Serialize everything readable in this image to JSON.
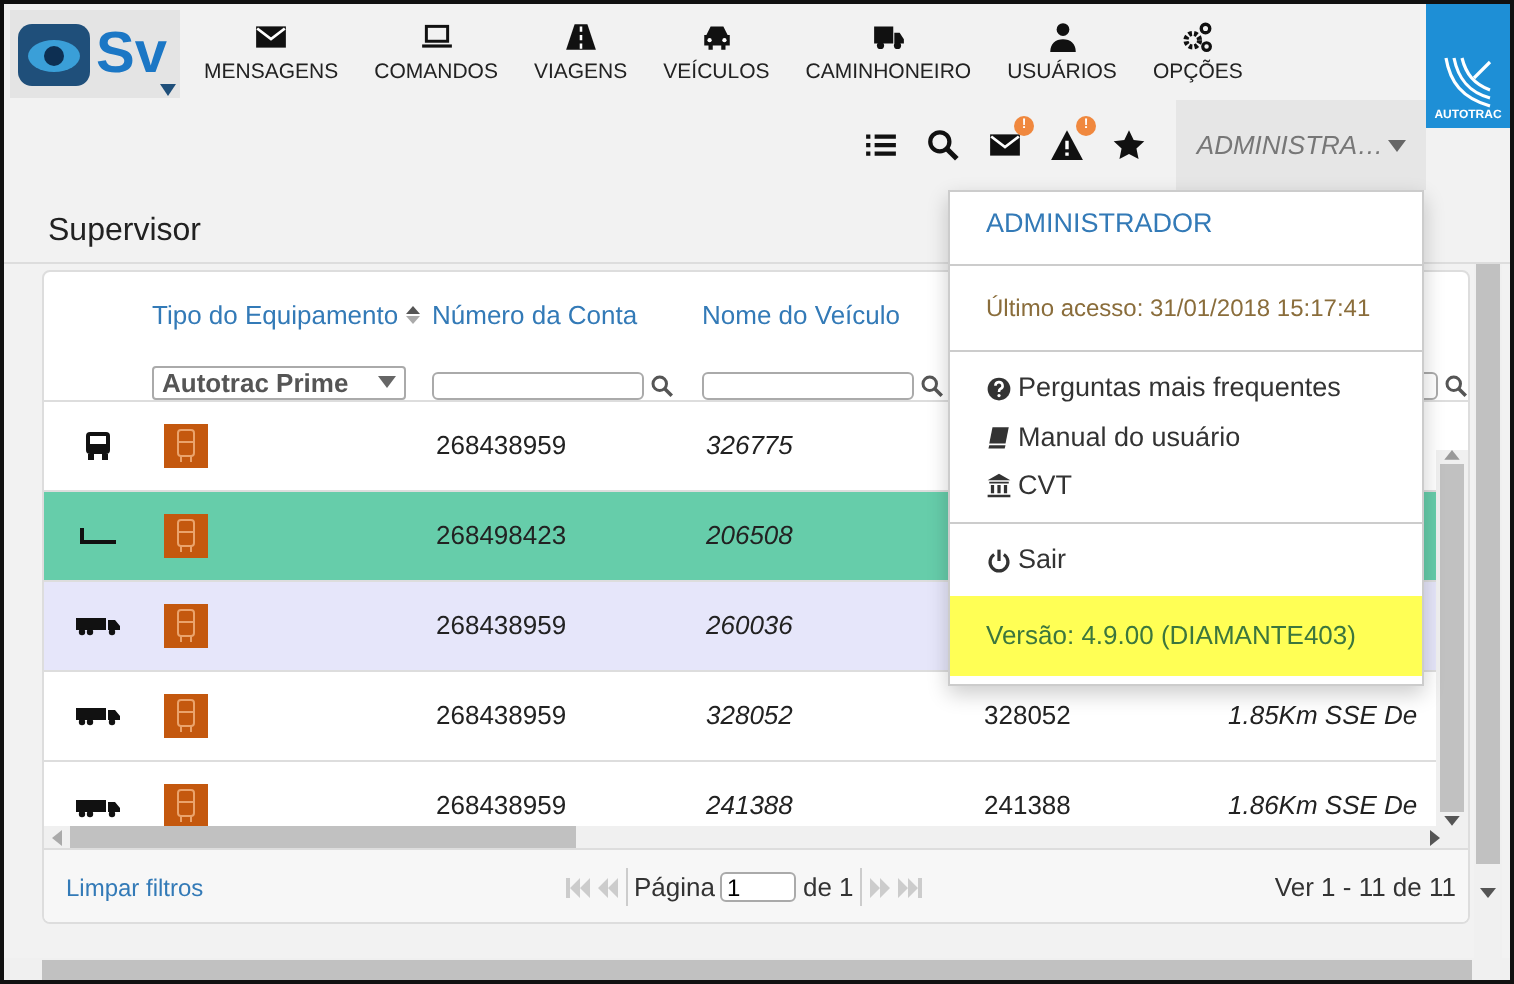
{
  "app": {
    "logo_text": "Sv"
  },
  "nav": [
    {
      "kind": "envelope",
      "label": "MENSAGENS"
    },
    {
      "kind": "laptop",
      "label": "COMANDOS"
    },
    {
      "kind": "road",
      "label": "VIAGENS"
    },
    {
      "kind": "car",
      "label": "VEÍCULOS"
    },
    {
      "kind": "truck",
      "label": "CAMINHONEIRO"
    },
    {
      "kind": "user",
      "label": "USUÁRIOS"
    },
    {
      "kind": "gears",
      "label": "OPÇÕES"
    }
  ],
  "brand": {
    "label": "AUTOTRAC"
  },
  "toolbar": [
    {
      "kind": "list"
    },
    {
      "kind": "search"
    },
    {
      "kind": "envelope",
      "badge": "!"
    },
    {
      "kind": "warning",
      "badge": "!"
    },
    {
      "kind": "star"
    }
  ],
  "user_menu": {
    "label": "ADMINISTRA…",
    "expanded": true
  },
  "page_title": "Supervisor",
  "table": {
    "columns": [
      {
        "label": "Tipo do Equipamento",
        "sortable": true
      },
      {
        "label": "Número da Conta"
      },
      {
        "label": "Nome do Veículo"
      }
    ],
    "filters": [
      {
        "kind": "select",
        "value": "Autotrac Prime"
      },
      {
        "kind": "search"
      },
      {
        "kind": "search"
      },
      {
        "kind": "none"
      },
      {
        "kind": "search"
      }
    ],
    "rows": [
      {
        "kind": "bus",
        "account": "268438959",
        "name": "326775",
        "selected": false,
        "highlighted": false
      },
      {
        "kind": "trailer",
        "account": "268498423",
        "name": "206508",
        "selected": true,
        "highlighted": false
      },
      {
        "kind": "truck",
        "account": "268438959",
        "name": "260036",
        "selected": false,
        "highlighted": true
      },
      {
        "kind": "truck",
        "account": "268438959",
        "name": "328052",
        "column_5": "328052",
        "column_6": "1.85Km SSE De",
        "selected": false,
        "highlighted": false
      },
      {
        "kind": "truck",
        "account": "268438959",
        "name": "241388",
        "column_5": "241388",
        "column_6": "1.86Km SSE De",
        "selected": false,
        "highlighted": false
      }
    ]
  },
  "footer": {
    "clear_filters": "Limpar filtros",
    "page_label": "Página",
    "page_value": "1",
    "page_total": "de 1",
    "nav_disabled": true,
    "summary": "Ver 1 - 11 de 11"
  },
  "menu": {
    "title": "ADMINISTRADOR",
    "last_access": "Último acesso: 31/01/2018 15:17:41",
    "links": [
      {
        "kind": "question",
        "label": "Perguntas mais frequentes"
      },
      {
        "kind": "book",
        "label": "Manual do usuário"
      },
      {
        "kind": "bank",
        "label": "CVT"
      }
    ],
    "logout": {
      "kind": "power",
      "label": "Sair"
    },
    "version": "Versão: 4.9.00 (DIAMANTE403)"
  }
}
